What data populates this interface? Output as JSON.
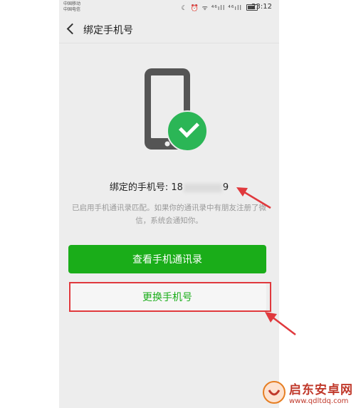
{
  "statusbar": {
    "carrier_1": "中国移动",
    "carrier_2": "中国电信",
    "icons": "☾ ⏰ ᯤ ⁴⁶ıll ⁴⁶ıll",
    "time": "23:12"
  },
  "navbar": {
    "back_icon": "chevron-left-icon",
    "title": "绑定手机号"
  },
  "status": {
    "phone_label": "绑定的手机号: ",
    "phone_prefix": "18",
    "phone_suffix": "9",
    "description": "已启用手机通讯录匹配。如果你的通讯录中有朋友注册了微信，系统会通知你。"
  },
  "buttons": {
    "view_contacts": "查看手机通讯录",
    "change_number": "更换手机号"
  },
  "watermark": {
    "name": "启东安卓网",
    "url": "www.qdltdq.com"
  },
  "colors": {
    "accent_green": "#1aad19",
    "annotation_red": "#e0393d",
    "background": "#ededed"
  }
}
